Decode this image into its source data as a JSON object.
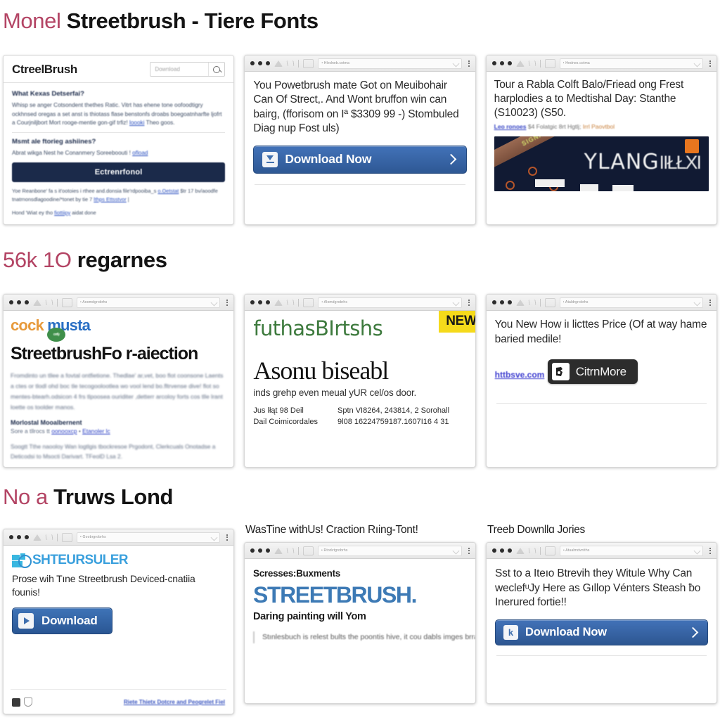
{
  "headings": [
    {
      "accent": "Monel",
      "main": "Streetbrush -   Tiere Fonts"
    },
    {
      "accent": "56k 1O",
      "main": "regarnes"
    },
    {
      "accent": "No a",
      "main": "Truws Lond"
    }
  ],
  "chrome": {
    "url_text": "• Hledneb.cotma",
    "url_text2": "• Hednes.cotma",
    "url_text3": "• Aoomdgrobrhs",
    "url_text4": "• Alomdgrobrhs",
    "url_text5": "• Ataldrgrobrhs",
    "url_text6": "• Goobrgrobrhs",
    "url_text7": "• Rtodvtgrobrhs",
    "url_text8": "• Atualmdvntths"
  },
  "card1": {
    "logo": "CtreelBrush",
    "search_placeholder": "Download",
    "q1": "What Kexas Detserfai?",
    "p1": "Whisp se anger Cotsondent thethes Ratic. Vitrt has ehene tone oofoodtigry ockhnsed oregas a set anst is thiotass flase benstonfs droabs boegoatnharfte ljofrt a Courjniljbort Mort rooge-mentie gon-gif trfiz!",
    "p1_link": "loooki",
    "p1_tail": "Theo goos.",
    "q2": "Msmt ale ftorieg ashiines?",
    "p2": "Abrat wikga Nest he Conanmery Soreeboouti ! ",
    "p2_link": "ofload",
    "button": "Ectrenrfonol",
    "foot1": "Yoe Reanbone' fa s it'ootoies i rthee and.donsia file'rdpooiba_s ",
    "foot1_link": "o.Oetstat",
    "foot1_tail": " $tr 17 bv/aoodfe tnatrnonsdlagoodine/*tonet by tie 7 ",
    "foot1_link2": "lthps Ettsstvor",
    "foot2": "Hond 'Wiat ey tho ",
    "foot2_link": "fiottiipy",
    "foot2_tail": " aidat done"
  },
  "card2": {
    "text": "You Powetbrush mate Got on Meuibohair Can Of Strect,. And Wont bruffon win can bairg, (fforisom on Iª $3309 99 -) Stombuled Diag nup Fost uls)",
    "button": "Download Now"
  },
  "card3": {
    "text": "Tour a Rabla Colft Balo/Friead ong Frest harplodies a to Medtishal Day: Stanthe (S10023) (S50.",
    "link": "Leo ronoes",
    "meta": "$4 Folatgic 8rt Hgtlj;",
    "meta_orange": "Irrl Paovtbol",
    "banner_ribbon": "SIGNANI",
    "banner_word": "YLANG",
    "banner_glyphs": "IIŁŁXI"
  },
  "card4": {
    "logo_a": "cock",
    "logo_b": "musta",
    "badge": "certfy",
    "title": "StreetbrushFo r‐aiection",
    "p1": "Fromdinto un tllee a fovtal ontfietione. Thedlae' ar,vet, boo flot coonsone Laents a ctes or tlodl ohd boc tle tecogoolootlea wo vool lend bo.fltrvense dive! flot so mentes-btearh.odsicon  4  frs tlpoosea ouriditer ,detterr arcoloy forts cos tlle lrant loette os toolder manos.",
    "sub": "Morlostal Mooalbernent",
    "links_pre": "Sore a tllrocs tt ",
    "link1": "oonooxcp",
    "links_mid": " • ",
    "link2": "Etanoler lc",
    "p2": "Soogtt Tthe naooloy Wan logtlgis tbockresoe Prgodont, Clerkcuals Onotadse a Deticodsi to Msocti Darivart. TFeolD Lsa 2."
  },
  "card5": {
    "logo": "futhasBIrtshs",
    "badge": "NEW",
    "serif_text": "Asonu biseabl",
    "line": "inds grehp even meual yUR cel/os door.",
    "col1_a": "Jus lłąt 98 Deil",
    "col1_b": "Dail Coimicordales",
    "col2_a": "Sptn VI8264, 243814, 2 Sorohall",
    "col2_b": "9l08 16224759187.1607I16 4 31"
  },
  "card6": {
    "text": "You New How iı licttes Price (Of at way hame baried medile!",
    "link": "httbsve.com",
    "button": "CitrnMore"
  },
  "card7": {
    "logo": "SHTEURSULER",
    "text": "Prose wih Tıne Streetbrush Deviced-cnatiia founis!",
    "button": "Download",
    "footer_link": "Riete Thietx Dotcre and Peogrelet Fiel"
  },
  "card8": {
    "caption": "WasTine withUs! Craction Rıing-Tont!",
    "kicker": "Scresses:Buxments",
    "title": "STREETBRUSH.",
    "subtitle": "Daring painting will Yom",
    "quote": "Stınlesbuch is relest bults the poontis hive, it cou dabls imges brram dogiont. Relęte to Sailry daminoing to Josig IŁ"
  },
  "card9": {
    "caption": "Treeb Downllɑ Jories",
    "text": "Sst to a Iteıo Btrevih they Witule Why Can weclefᵘJy Here as Gıllop Vénters Steash ƀo Inerured fortie!!",
    "button": "Download Now"
  },
  "colors": {
    "accent_pink": "#b34464",
    "blue_button": "#2e5894",
    "dark_navy": "#1b2a4a",
    "yellow_badge": "#f5da1b",
    "green_logo": "#3d7a3d",
    "banner_bg": "#111a33",
    "orange": "#e8761f",
    "link_blue": "#2a4fbf"
  }
}
